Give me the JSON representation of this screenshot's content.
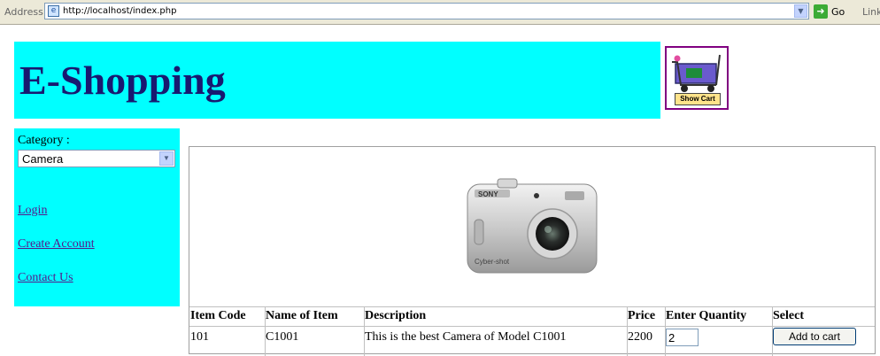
{
  "browser": {
    "address_label": "Address",
    "url": "http://localhost/index.php",
    "go_label": "Go",
    "links_label": "Link"
  },
  "header": {
    "title": "E-Shopping",
    "banner_color": "#00ffff",
    "title_color": "#191970",
    "cart_button_label": "Show Cart"
  },
  "sidebar": {
    "category_label": "Category :",
    "category_selected": "Camera",
    "links": [
      "Login",
      "Create Account",
      "Contact Us"
    ]
  },
  "product_table": {
    "columns": [
      "Item Code",
      "Name of Item",
      "Description",
      "Price",
      "Enter Quantity",
      "Select"
    ],
    "row": {
      "item_code": "101",
      "name": "C1001",
      "description": "This is the best Camera of Model C1001",
      "price": "2200",
      "quantity": "2",
      "select_label": "Add to cart"
    },
    "camera_brand": "SONY",
    "camera_model": "Cyber-shot"
  }
}
